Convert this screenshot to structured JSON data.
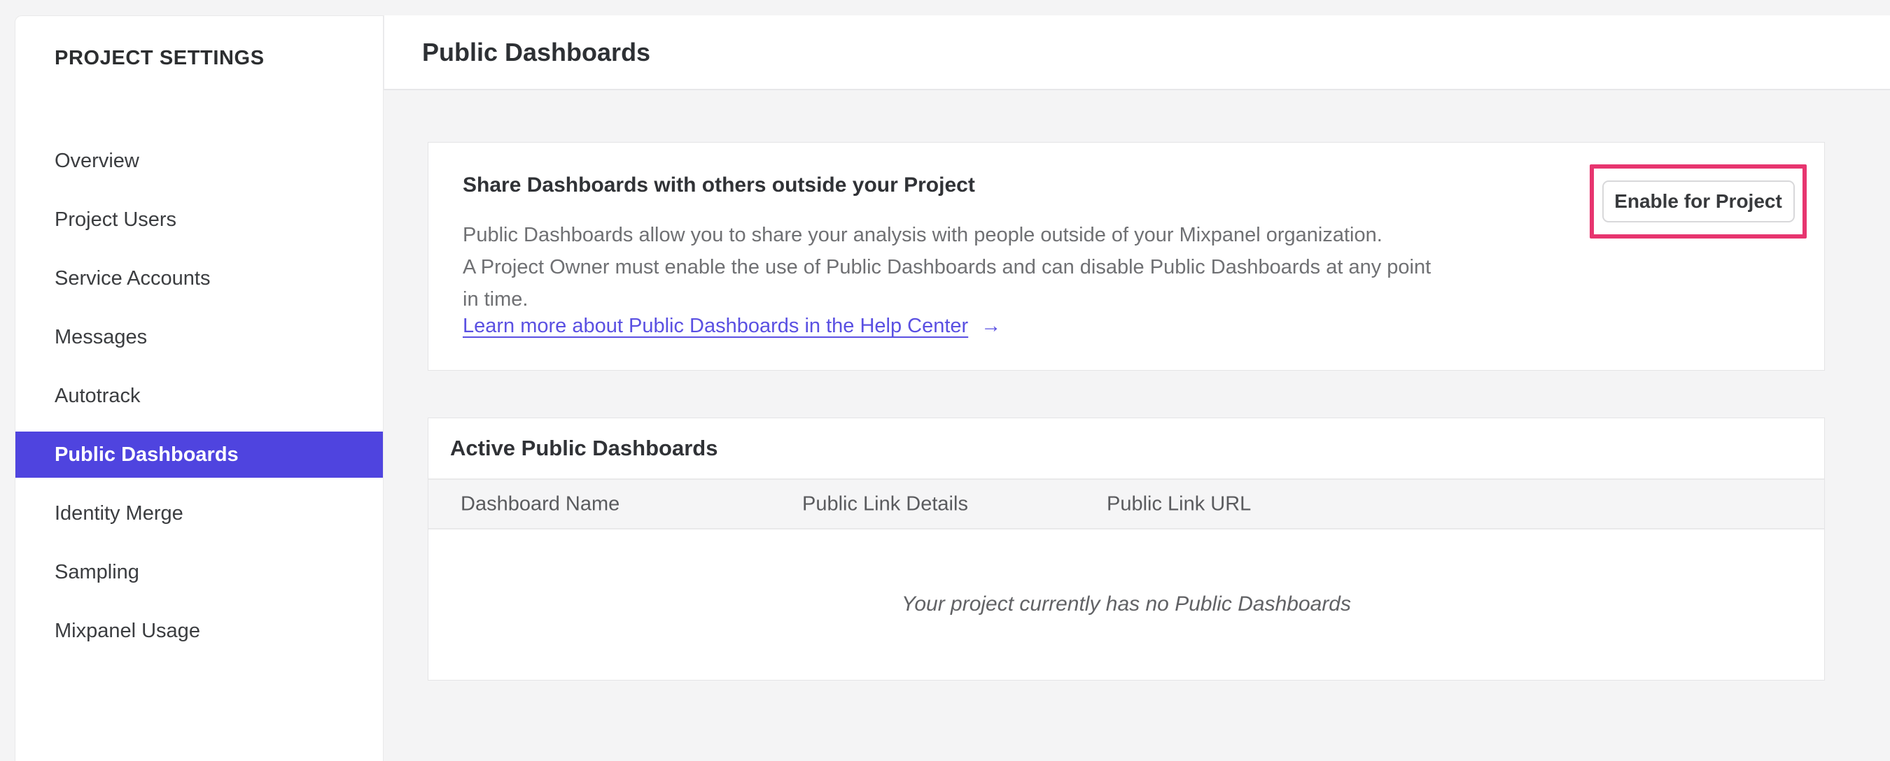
{
  "sidebar": {
    "title": "PROJECT SETTINGS",
    "items": [
      {
        "label": "Overview",
        "selected": false
      },
      {
        "label": "Project Users",
        "selected": false
      },
      {
        "label": "Service Accounts",
        "selected": false
      },
      {
        "label": "Messages",
        "selected": false
      },
      {
        "label": "Autotrack",
        "selected": false
      },
      {
        "label": "Public Dashboards",
        "selected": true
      },
      {
        "label": "Identity Merge",
        "selected": false
      },
      {
        "label": "Sampling",
        "selected": false
      },
      {
        "label": "Mixpanel Usage",
        "selected": false
      }
    ]
  },
  "header": {
    "title": "Public Dashboards"
  },
  "share_card": {
    "heading": "Share Dashboards with others outside your Project",
    "description_lines": [
      "Public Dashboards allow you to share your analysis with people outside of your Mixpanel organization.",
      "A Project Owner must enable the use of Public Dashboards and can disable Public Dashboards at any point",
      "in time."
    ],
    "link_label": "Learn more about Public Dashboards in the Help Center",
    "link_arrow": "→",
    "button_label": "Enable for Project"
  },
  "active_card": {
    "heading": "Active Public Dashboards",
    "columns": [
      "Dashboard Name",
      "Public Link Details",
      "Public Link URL"
    ],
    "empty_message": "Your project currently has no Public Dashboards"
  },
  "colors": {
    "accent_purple": "#4f44df",
    "link_purple": "#5a50e2",
    "annotation_pink": "#e7356f",
    "page_background": "#f4f4f5"
  }
}
